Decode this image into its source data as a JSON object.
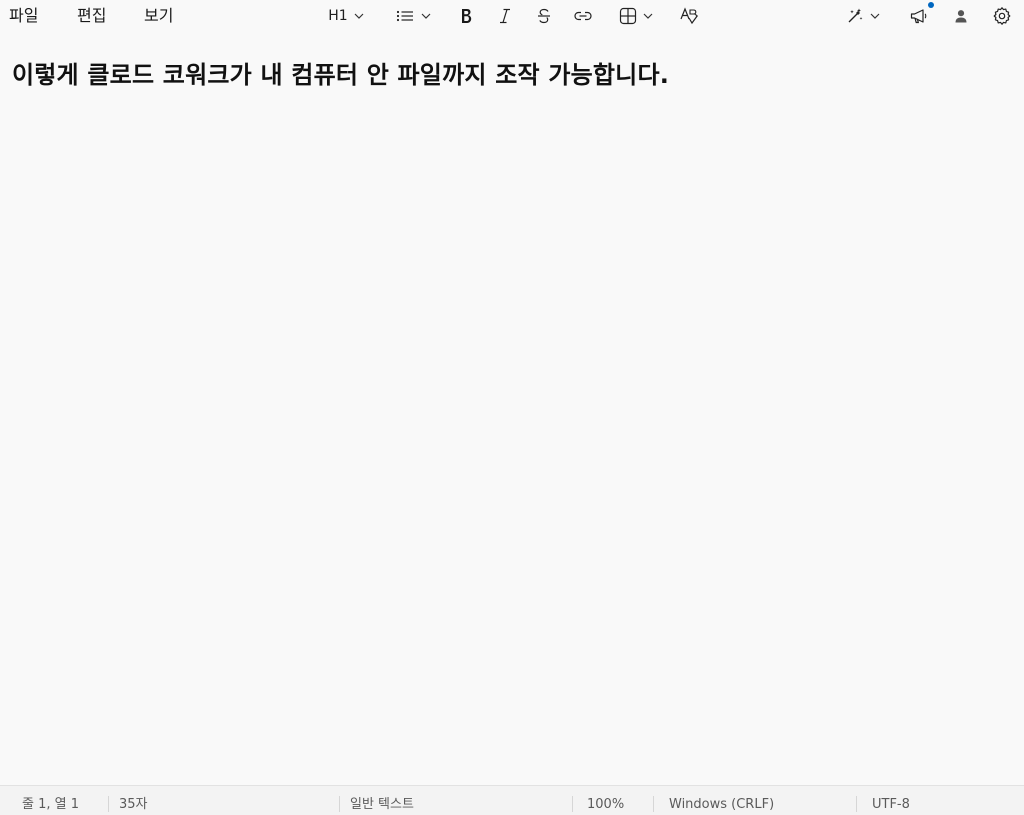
{
  "menu": {
    "file": "파일",
    "edit": "편집",
    "view": "보기"
  },
  "toolbar": {
    "heading_label": "H1",
    "icons": [
      "heading-dropdown",
      "list-icon",
      "bold-icon",
      "italic-icon",
      "strikethrough-icon",
      "link-icon",
      "table-icon",
      "clear-formatting-icon",
      "copilot-icon",
      "announcement-icon",
      "account-icon",
      "settings-icon"
    ],
    "accent_color": "#0067c0"
  },
  "document": {
    "heading": "이렇게 클로드 코워크가 내 컴퓨터 안 파일까지 조작 가능합니다."
  },
  "status": {
    "position": "줄 1, 열 1",
    "char_count": "35자",
    "format": "일반 텍스트",
    "zoom": "100%",
    "line_ending": "Windows (CRLF)",
    "encoding": "UTF-8"
  }
}
